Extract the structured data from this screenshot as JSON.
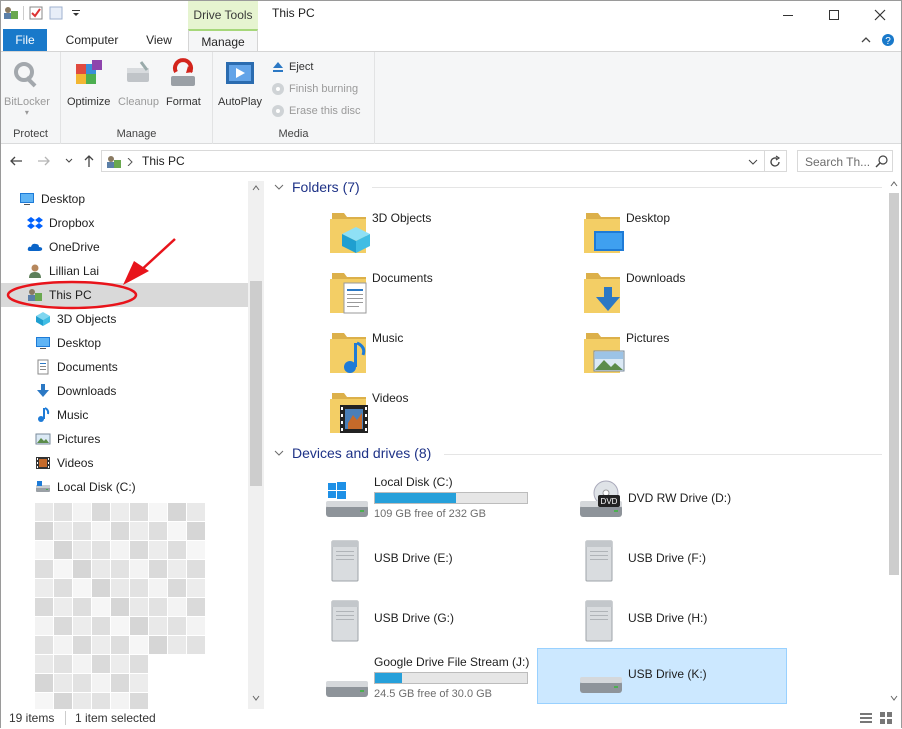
{
  "titlebar": {
    "context_tab": "Drive Tools",
    "title": "This PC"
  },
  "tabs": {
    "file": "File",
    "computer": "Computer",
    "view": "View",
    "manage": "Manage"
  },
  "ribbon": {
    "protect": {
      "bitlocker": "BitLocker",
      "label": "Protect"
    },
    "manage": {
      "optimize": "Optimize",
      "cleanup": "Cleanup",
      "format": "Format",
      "label": "Manage"
    },
    "media": {
      "autoplay": "AutoPlay",
      "eject": "Eject",
      "finish_burning": "Finish burning",
      "erase": "Erase this disc",
      "label": "Media"
    }
  },
  "address": {
    "crumb": "This PC",
    "search_placeholder": "Search Th..."
  },
  "nav": {
    "items": [
      {
        "label": "Desktop",
        "icon": "desktop-icon"
      },
      {
        "label": "Dropbox",
        "icon": "dropbox-icon"
      },
      {
        "label": "OneDrive",
        "icon": "onedrive-icon"
      },
      {
        "label": "Lillian Lai",
        "icon": "user-icon"
      },
      {
        "label": "This PC",
        "icon": "this-pc-icon",
        "selected": true
      },
      {
        "label": "3D Objects",
        "icon": "3d-objects-icon"
      },
      {
        "label": "Desktop",
        "icon": "desktop-icon"
      },
      {
        "label": "Documents",
        "icon": "documents-icon"
      },
      {
        "label": "Downloads",
        "icon": "downloads-icon"
      },
      {
        "label": "Music",
        "icon": "music-icon"
      },
      {
        "label": "Pictures",
        "icon": "pictures-icon"
      },
      {
        "label": "Videos",
        "icon": "videos-icon"
      },
      {
        "label": "Local Disk (C:)",
        "icon": "local-disk-icon"
      }
    ]
  },
  "folders": {
    "header": "Folders (7)",
    "items": [
      {
        "name": "3D Objects",
        "icon": "3d-objects-folder-icon"
      },
      {
        "name": "Desktop",
        "icon": "desktop-folder-icon"
      },
      {
        "name": "Documents",
        "icon": "documents-folder-icon"
      },
      {
        "name": "Downloads",
        "icon": "downloads-folder-icon"
      },
      {
        "name": "Music",
        "icon": "music-folder-icon"
      },
      {
        "name": "Pictures",
        "icon": "pictures-folder-icon"
      },
      {
        "name": "Videos",
        "icon": "videos-folder-icon"
      }
    ]
  },
  "drives": {
    "header": "Devices and drives (8)",
    "items": [
      {
        "name": "Local Disk (C:)",
        "free": "109 GB free of 232 GB",
        "used_fraction": 0.53,
        "icon": "windows-disk-icon"
      },
      {
        "name": "DVD RW Drive (D:)",
        "icon": "dvd-drive-icon"
      },
      {
        "name": "USB Drive (E:)",
        "icon": "usb-drive-icon"
      },
      {
        "name": "USB Drive (F:)",
        "icon": "usb-drive-icon"
      },
      {
        "name": "USB Drive (G:)",
        "icon": "usb-drive-icon"
      },
      {
        "name": "USB Drive (H:)",
        "icon": "usb-drive-icon"
      },
      {
        "name": "Google Drive File Stream (J:)",
        "free": "24.5 GB free of 30.0 GB",
        "used_fraction": 0.18,
        "icon": "network-disk-icon"
      },
      {
        "name": "USB Drive (K:)",
        "icon": "usb-disk-icon",
        "selected": true
      }
    ]
  },
  "status": {
    "items": "19 items",
    "selected": "1 item selected"
  },
  "colors": {
    "accent": "#1979ca",
    "context_tab": "#e6f4d0",
    "selection": "#cce8ff",
    "progress": "#26a0da",
    "annotation": "#e8141b"
  }
}
